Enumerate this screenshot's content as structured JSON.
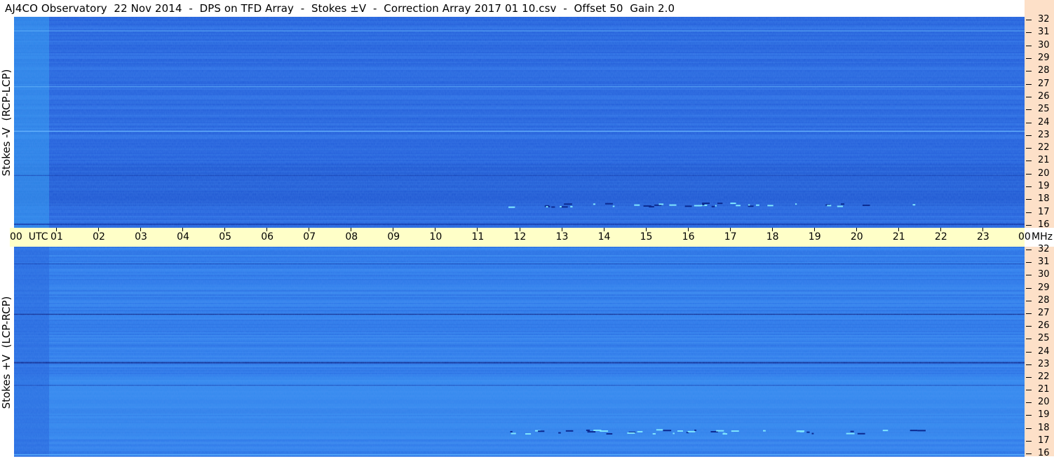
{
  "title": "AJ4CO Observatory  22 Nov 2014  -  DPS on TFD Array  -  Stokes ±V  -  Correction Array 2017 01 10.csv  -  Offset 50  Gain 2.0",
  "panels": [
    {
      "id": "top",
      "ylabel": "Stokes -V  (RCP-LCP)"
    },
    {
      "id": "bottom",
      "ylabel": "Stokes +V  (LCP-RCP)"
    }
  ],
  "time_axis": {
    "first_label": "00  UTC",
    "last_label": "00",
    "unit_label": "MHz",
    "labels": [
      "01",
      "02",
      "03",
      "04",
      "05",
      "06",
      "07",
      "08",
      "09",
      "10",
      "11",
      "12",
      "13",
      "14",
      "15",
      "16",
      "17",
      "18",
      "19",
      "20",
      "21",
      "22",
      "23"
    ]
  },
  "freq_axis": {
    "labels": [
      "32",
      "31",
      "30",
      "29",
      "28",
      "27",
      "26",
      "25",
      "24",
      "23",
      "22",
      "21",
      "20",
      "19",
      "18",
      "17",
      "16"
    ]
  },
  "colors": {
    "background_blue": "#2f6fe0",
    "freq_axis_bg": "#fde0c8",
    "time_axis_bg": "#ffffc8"
  },
  "chart_data": {
    "type": "heatmap",
    "title": "AJ4CO Observatory  22 Nov 2014  -  DPS on TFD Array  -  Stokes ±V  -  Correction Array 2017 01 10.csv  -  Offset 50  Gain 2.0",
    "x_axis": {
      "label": "UTC",
      "range": [
        0,
        24
      ],
      "ticks": [
        "00",
        "01",
        "02",
        "03",
        "04",
        "05",
        "06",
        "07",
        "08",
        "09",
        "10",
        "11",
        "12",
        "13",
        "14",
        "15",
        "16",
        "17",
        "18",
        "19",
        "20",
        "21",
        "22",
        "23",
        "00"
      ]
    },
    "y_axis": {
      "label": "MHz",
      "range": [
        16,
        32
      ],
      "ticks": [
        32,
        31,
        30,
        29,
        28,
        27,
        26,
        25,
        24,
        23,
        22,
        21,
        20,
        19,
        18,
        17,
        16
      ]
    },
    "panels": [
      {
        "name": "Stokes -V  (RCP-LCP)",
        "colormap": "blue spectrum",
        "notes": "mostly uniform blue with horizontal RFI bands near 23 and 27 MHz"
      },
      {
        "name": "Stokes +V  (LCP-RCP)",
        "colormap": "blue spectrum",
        "notes": "mostly uniform blue; dark line near 23 and 27 MHz"
      }
    ]
  }
}
